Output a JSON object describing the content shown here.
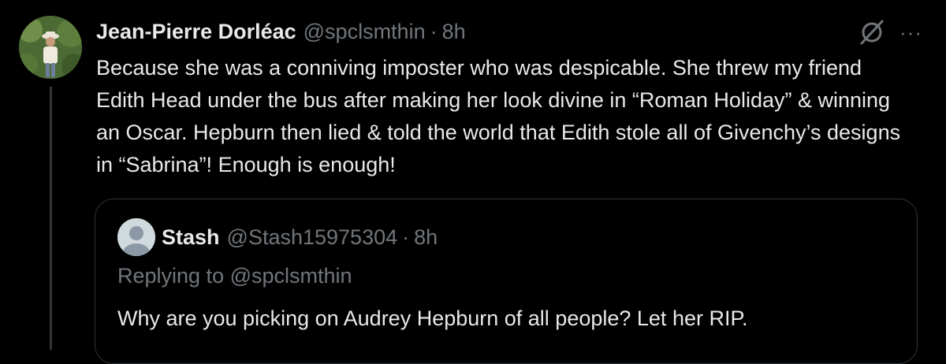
{
  "tweet": {
    "author_name": "Jean-Pierre Dorléac",
    "author_handle": "@spclsmthin",
    "separator": "·",
    "time": "8h",
    "body": "Because she was a conniving imposter who was despicable. She threw my friend Edith Head under the bus after making her look divine in “Roman Holiday” & winning an Oscar. Hepburn then lied & told the world that Edith stole all of Givenchy’s designs in “Sabrina”! Enough is enough!",
    "more_label": "···",
    "icons": {
      "avatar": "profile-photo",
      "grok": "grok-icon",
      "more": "more-icon"
    }
  },
  "quote": {
    "author_name": "Stash",
    "author_handle": "@Stash15975304",
    "separator": "·",
    "time": "8h",
    "replying_prefix": "Replying to",
    "replying_handle": "@spclsmthin",
    "body": "Why are you picking on Audrey Hepburn of all people? Let her RIP.",
    "icons": {
      "avatar": "default-avatar"
    }
  },
  "colors": {
    "background": "#000000",
    "text": "#e7e9ea",
    "muted": "#71767b",
    "border": "#2f3336"
  }
}
